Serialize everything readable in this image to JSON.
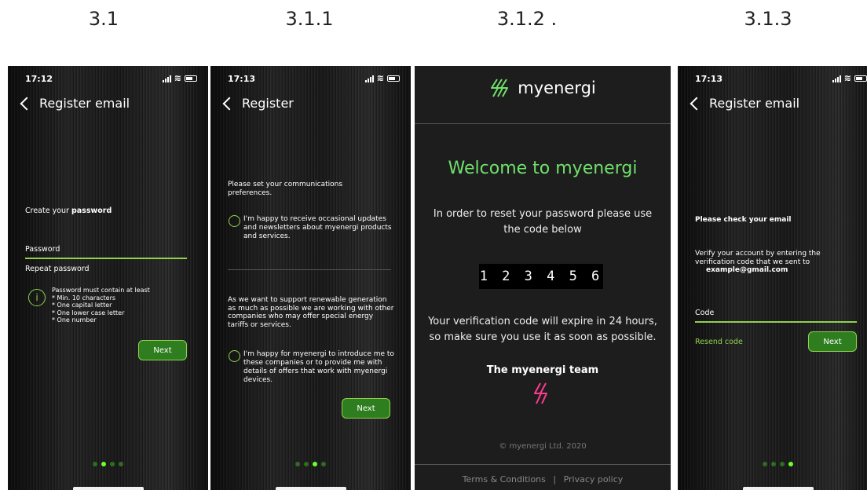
{
  "steps": [
    "3.1",
    "3.1.1",
    "3.1.2 .",
    "3.1.3"
  ],
  "phone1": {
    "time": "17:12",
    "title": "Register email",
    "create_prefix": "Create your ",
    "create_bold": "password",
    "password_label": "Password",
    "repeat_label": "Repeat password",
    "info_icon_glyph": "i",
    "rules_intro": "Password must contain at least",
    "rules": [
      "* Min. 10 characters",
      "* One capital letter",
      "* One lower case letter",
      "* One number"
    ],
    "next": "Next",
    "active_dot": 1
  },
  "phone2": {
    "time": "17:13",
    "title": "Register",
    "comm_text": "Please set your communications preferences.",
    "option1": "I'm happy to receive occasional updates and newsletters about myenergi products and services.",
    "support_text": "As we want to support renewable generation as much as possible we are working with other companies who may offer special energy tariffs or services.",
    "option2": "I'm happy for myenergi to introduce me to these companies or to provide me with details of offers that work with myenergi devices.",
    "next": "Next",
    "active_dot": 2
  },
  "email": {
    "brand": "myenergi",
    "welcome": "Welcome to myenergi",
    "intro": "In order to reset your password please use the code below",
    "code": "1 2 3 4 5 6",
    "expiry": "Your verification code will expire in 24 hours, so make sure you use it as soon as possible.",
    "team": "The myenergi team",
    "copyright": "© myenergi Ltd. 2020",
    "terms": "Terms & Conditions",
    "separator": "|",
    "privacy": "Privacy policy",
    "accent_color": "#6fe06a",
    "logo_color_pink": "#ff3b8d"
  },
  "phone3": {
    "time": "17:13",
    "title": "Register email",
    "check_heading": "Please check your email",
    "verify_text": "Verify your account by entering the verification code that we sent to",
    "email_address": "example@gmail.com",
    "code_label": "Code",
    "resend": "Resend code",
    "next": "Next",
    "active_dot": 3
  },
  "colors": {
    "green": "#8fd14f",
    "button_green": "#2e7d1f",
    "dot_active": "#6cff2e"
  }
}
